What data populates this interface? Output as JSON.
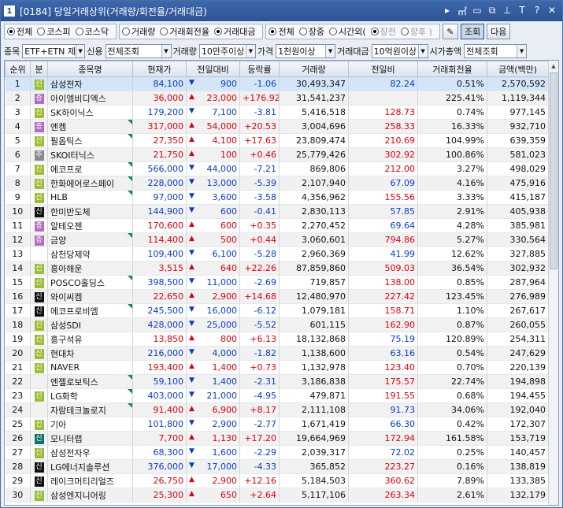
{
  "window": {
    "screen_no": "1",
    "title": "[0184] 당일거래상위(거래량/회전율/거래대금)",
    "icons": [
      "arrow-right-icon",
      "m-icon",
      "window-icon",
      "restore-icon",
      "pin-icon",
      "font-icon",
      "help-icon",
      "close-icon"
    ],
    "icon_glyphs": [
      "▸",
      "㎡",
      "▭",
      "⧉",
      "⊥",
      "T",
      "?",
      "✕"
    ]
  },
  "filters": {
    "market": [
      {
        "label": "전체",
        "on": true
      },
      {
        "label": "코스피",
        "on": false
      },
      {
        "label": "코스닥",
        "on": false
      }
    ],
    "rank_type": [
      {
        "label": "거래량",
        "on": false
      },
      {
        "label": "거래회전율",
        "on": false
      },
      {
        "label": "거래대금",
        "on": true
      }
    ],
    "session": [
      {
        "label": "전체",
        "on": true,
        "gray": false
      },
      {
        "label": "장중",
        "on": false,
        "gray": false
      },
      {
        "label": "시간외(",
        "on": false,
        "gray": false
      },
      {
        "label": "장전",
        "on": true,
        "gray": true
      },
      {
        "label": "장후 )",
        "on": false,
        "gray": true
      }
    ],
    "query_button": "조회",
    "next_button": "다음"
  },
  "options": {
    "item_label": "종목",
    "item_value": "ETF+ETN 제",
    "credit_label": "신용",
    "credit_value": "전체조회",
    "volume_label": "거래량",
    "volume_value": "10만주이상",
    "price_label": "가격",
    "price_value": "1천원이상",
    "amount_label": "거래대금",
    "amount_value": "10억원이상",
    "cap_label": "시가총액",
    "cap_value": "전체조회"
  },
  "table": {
    "headers": [
      "순위",
      "분",
      "종목명",
      "현재가",
      "전일대비",
      "등락률",
      "거래량",
      "전일비",
      "거래회전율",
      "금액(백만)"
    ],
    "rows": [
      {
        "rank": "1",
        "tag": "신",
        "tag_type": "sin",
        "name": "삼성전자",
        "mark": false,
        "price": "84,100",
        "dir": "down",
        "diff": "900",
        "rate": "-1.06",
        "volume": "30,493,347",
        "prev": "82.24",
        "prev_dir": "down",
        "turnover": "0.51%",
        "amount": "2,570,592"
      },
      {
        "rank": "2",
        "tag": "증",
        "tag_type": "jeung",
        "name": "아이엠비디엑스",
        "mark": false,
        "price": "36,000",
        "dir": "up",
        "diff": "23,000",
        "rate": "+176.92",
        "volume": "31,541,237",
        "prev": "",
        "prev_dir": "up",
        "turnover": "225.41%",
        "amount": "1,119,344"
      },
      {
        "rank": "3",
        "tag": "신",
        "tag_type": "sin",
        "name": "SK하이닉스",
        "mark": false,
        "price": "179,200",
        "dir": "down",
        "diff": "7,100",
        "rate": "-3.81",
        "volume": "5,416,518",
        "prev": "128.73",
        "prev_dir": "up",
        "turnover": "0.74%",
        "amount": "977,145"
      },
      {
        "rank": "4",
        "tag": "증",
        "tag_type": "jeung",
        "name": "엔켐",
        "mark": true,
        "price": "317,000",
        "dir": "up",
        "diff": "54,000",
        "rate": "+20.53",
        "volume": "3,004,696",
        "prev": "258.33",
        "prev_dir": "up",
        "turnover": "16.33%",
        "amount": "932,710"
      },
      {
        "rank": "5",
        "tag": "신",
        "tag_type": "sin",
        "name": "필옵틱스",
        "mark": true,
        "price": "27,350",
        "dir": "up",
        "diff": "4,100",
        "rate": "+17.63",
        "volume": "23,809,474",
        "prev": "210.69",
        "prev_dir": "up",
        "turnover": "104.99%",
        "amount": "639,359"
      },
      {
        "rank": "6",
        "tag": "주",
        "tag_type": "ju",
        "name": "SKOI터닉스",
        "mark": false,
        "price": "21,750",
        "dir": "up",
        "diff": "100",
        "rate": "+0.46",
        "volume": "25,779,426",
        "prev": "302.92",
        "prev_dir": "up",
        "turnover": "100.86%",
        "amount": "581,023"
      },
      {
        "rank": "7",
        "tag": "신",
        "tag_type": "sin",
        "name": "에코프로",
        "mark": true,
        "price": "566,000",
        "dir": "down",
        "diff": "44,000",
        "rate": "-7.21",
        "volume": "869,806",
        "prev": "212.00",
        "prev_dir": "up",
        "turnover": "3.27%",
        "amount": "498,029"
      },
      {
        "rank": "8",
        "tag": "신",
        "tag_type": "sin",
        "name": "한화에어로스페이",
        "mark": true,
        "price": "228,000",
        "dir": "down",
        "diff": "13,000",
        "rate": "-5.39",
        "volume": "2,107,940",
        "prev": "67.09",
        "prev_dir": "down",
        "turnover": "4.16%",
        "amount": "475,916"
      },
      {
        "rank": "9",
        "tag": "신",
        "tag_type": "sin",
        "name": "HLB",
        "mark": true,
        "price": "97,000",
        "dir": "down",
        "diff": "3,600",
        "rate": "-3.58",
        "volume": "4,356,962",
        "prev": "155.56",
        "prev_dir": "up",
        "turnover": "3.33%",
        "amount": "415,187"
      },
      {
        "rank": "10",
        "tag": "신",
        "tag_type": "sin2",
        "name": "한미반도체",
        "mark": false,
        "price": "144,900",
        "dir": "down",
        "diff": "600",
        "rate": "-0.41",
        "volume": "2,830,113",
        "prev": "57.85",
        "prev_dir": "down",
        "turnover": "2.91%",
        "amount": "405,938"
      },
      {
        "rank": "11",
        "tag": "증",
        "tag_type": "jeung",
        "name": "알테오젠",
        "mark": false,
        "price": "170,600",
        "dir": "up",
        "diff": "600",
        "rate": "+0.35",
        "volume": "2,270,452",
        "prev": "69.64",
        "prev_dir": "down",
        "turnover": "4.28%",
        "amount": "385,981"
      },
      {
        "rank": "12",
        "tag": "증",
        "tag_type": "jeung",
        "name": "금양",
        "mark": true,
        "price": "114,400",
        "dir": "up",
        "diff": "500",
        "rate": "+0.44",
        "volume": "3,060,601",
        "prev": "794.86",
        "prev_dir": "up",
        "turnover": "5.27%",
        "amount": "330,564"
      },
      {
        "rank": "13",
        "tag": "",
        "tag_type": "",
        "name": "삼천당제약",
        "mark": false,
        "price": "109,400",
        "dir": "down",
        "diff": "6,100",
        "rate": "-5.28",
        "volume": "2,960,369",
        "prev": "41.99",
        "prev_dir": "down",
        "turnover": "12.62%",
        "amount": "327,885"
      },
      {
        "rank": "14",
        "tag": "신",
        "tag_type": "sin",
        "name": "흥아해운",
        "mark": false,
        "price": "3,515",
        "dir": "up",
        "diff": "640",
        "rate": "+22.26",
        "volume": "87,859,860",
        "prev": "509.03",
        "prev_dir": "up",
        "turnover": "36.54%",
        "amount": "302,932"
      },
      {
        "rank": "15",
        "tag": "신",
        "tag_type": "sin",
        "name": "POSCO홀딩스",
        "mark": true,
        "price": "398,500",
        "dir": "down",
        "diff": "11,000",
        "rate": "-2.69",
        "volume": "719,857",
        "prev": "138.00",
        "prev_dir": "up",
        "turnover": "0.85%",
        "amount": "287,964"
      },
      {
        "rank": "16",
        "tag": "신",
        "tag_type": "sin2",
        "name": "와이씨켐",
        "mark": false,
        "price": "22,650",
        "dir": "up",
        "diff": "2,900",
        "rate": "+14.68",
        "volume": "12,480,970",
        "prev": "227.42",
        "prev_dir": "up",
        "turnover": "123.45%",
        "amount": "276,989"
      },
      {
        "rank": "17",
        "tag": "신",
        "tag_type": "sin2",
        "name": "에코프로비엠",
        "mark": true,
        "price": "245,500",
        "dir": "down",
        "diff": "16,000",
        "rate": "-6.12",
        "volume": "1,079,181",
        "prev": "158.71",
        "prev_dir": "up",
        "turnover": "1.10%",
        "amount": "267,617"
      },
      {
        "rank": "18",
        "tag": "신",
        "tag_type": "sin",
        "name": "삼성SDI",
        "mark": false,
        "price": "428,000",
        "dir": "down",
        "diff": "25,000",
        "rate": "-5.52",
        "volume": "601,115",
        "prev": "162.90",
        "prev_dir": "up",
        "turnover": "0.87%",
        "amount": "260,055"
      },
      {
        "rank": "19",
        "tag": "신",
        "tag_type": "sin",
        "name": "흥구석유",
        "mark": false,
        "price": "13,850",
        "dir": "up",
        "diff": "800",
        "rate": "+6.13",
        "volume": "18,132,868",
        "prev": "75.19",
        "prev_dir": "down",
        "turnover": "120.89%",
        "amount": "254,311"
      },
      {
        "rank": "20",
        "tag": "신",
        "tag_type": "sin",
        "name": "현대차",
        "mark": false,
        "price": "216,000",
        "dir": "down",
        "diff": "4,000",
        "rate": "-1.82",
        "volume": "1,138,600",
        "prev": "63.16",
        "prev_dir": "down",
        "turnover": "0.54%",
        "amount": "247,629"
      },
      {
        "rank": "21",
        "tag": "신",
        "tag_type": "sin",
        "name": "NAVER",
        "mark": false,
        "price": "193,400",
        "dir": "up",
        "diff": "1,400",
        "rate": "+0.73",
        "volume": "1,132,978",
        "prev": "123.40",
        "prev_dir": "up",
        "turnover": "0.70%",
        "amount": "220,139"
      },
      {
        "rank": "22",
        "tag": "",
        "tag_type": "",
        "name": "엔젤로보틱스",
        "mark": true,
        "price": "59,100",
        "dir": "down",
        "diff": "1,400",
        "rate": "-2.31",
        "volume": "3,186,838",
        "prev": "175.57",
        "prev_dir": "up",
        "turnover": "22.74%",
        "amount": "194,898"
      },
      {
        "rank": "23",
        "tag": "신",
        "tag_type": "sin",
        "name": "LG화학",
        "mark": true,
        "price": "403,000",
        "dir": "down",
        "diff": "21,000",
        "rate": "-4.95",
        "volume": "479,871",
        "prev": "191.55",
        "prev_dir": "up",
        "turnover": "0.68%",
        "amount": "194,455"
      },
      {
        "rank": "24",
        "tag": "",
        "tag_type": "",
        "name": "자람테크놀로지",
        "mark": true,
        "price": "91,400",
        "dir": "up",
        "diff": "6,900",
        "rate": "+8.17",
        "volume": "2,111,108",
        "prev": "91.73",
        "prev_dir": "down",
        "turnover": "34.06%",
        "amount": "192,040"
      },
      {
        "rank": "25",
        "tag": "신",
        "tag_type": "sin",
        "name": "기아",
        "mark": false,
        "price": "101,800",
        "dir": "down",
        "diff": "2,900",
        "rate": "-2.77",
        "volume": "1,671,419",
        "prev": "66.30",
        "prev_dir": "down",
        "turnover": "0.42%",
        "amount": "172,307"
      },
      {
        "rank": "26",
        "tag": "신",
        "tag_type": "sin3",
        "name": "모니터랩",
        "mark": false,
        "price": "7,700",
        "dir": "up",
        "diff": "1,130",
        "rate": "+17.20",
        "volume": "19,664,969",
        "prev": "172.94",
        "prev_dir": "up",
        "turnover": "161.58%",
        "amount": "153,719"
      },
      {
        "rank": "27",
        "tag": "신",
        "tag_type": "sin",
        "name": "삼성전자우",
        "mark": false,
        "price": "68,300",
        "dir": "down",
        "diff": "1,600",
        "rate": "-2.29",
        "volume": "2,039,317",
        "prev": "72.02",
        "prev_dir": "down",
        "turnover": "0.25%",
        "amount": "140,457"
      },
      {
        "rank": "28",
        "tag": "신",
        "tag_type": "sin2",
        "name": "LG에너지솔루션",
        "mark": false,
        "price": "376,000",
        "dir": "down",
        "diff": "17,000",
        "rate": "-4.33",
        "volume": "365,852",
        "prev": "223.27",
        "prev_dir": "up",
        "turnover": "0.16%",
        "amount": "138,819"
      },
      {
        "rank": "29",
        "tag": "신",
        "tag_type": "sin2",
        "name": "레이크머티리얼즈",
        "mark": false,
        "price": "26,750",
        "dir": "up",
        "diff": "2,900",
        "rate": "+12.16",
        "volume": "5,184,503",
        "prev": "360.62",
        "prev_dir": "up",
        "turnover": "7.89%",
        "amount": "133,385"
      },
      {
        "rank": "30",
        "tag": "신",
        "tag_type": "sin",
        "name": "삼성엔지니어링",
        "mark": false,
        "price": "25,300",
        "dir": "up",
        "diff": "650",
        "rate": "+2.64",
        "volume": "5,117,106",
        "prev": "263.34",
        "prev_dir": "up",
        "turnover": "2.61%",
        "amount": "132,179"
      }
    ]
  },
  "colors": {
    "up": "#d7000f",
    "down": "#0a3bc4",
    "selected_row": "#d3e5f7",
    "title_bar": "#2c5394"
  }
}
